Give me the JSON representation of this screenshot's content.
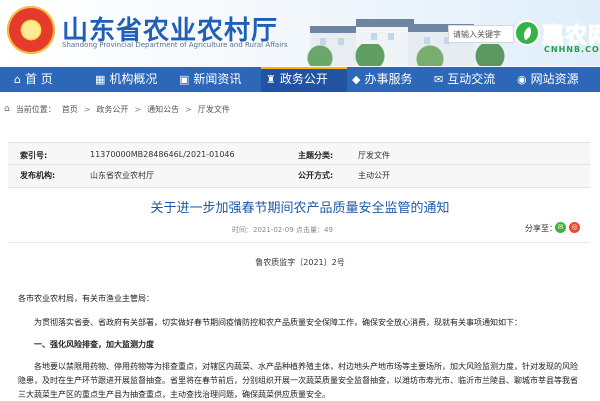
{
  "header": {
    "title": "山东省农业农村厅",
    "subtitle": "Shandong Provincial Department of Agriculture and Rural Affairs",
    "search_text": "请输入关键字",
    "logo_text": "惠农网",
    "logo_domain": "CNHNB.COM"
  },
  "nav": {
    "items": [
      {
        "label": "首 页",
        "icon": "home-icon"
      },
      {
        "label": "机构概况",
        "icon": "org-icon"
      },
      {
        "label": "新闻资讯",
        "icon": "news-icon"
      },
      {
        "label": "政务公开",
        "icon": "public-affairs-icon"
      },
      {
        "label": "办事服务",
        "icon": "service-icon"
      },
      {
        "label": "互动交流",
        "icon": "chat-icon"
      },
      {
        "label": "网站资源",
        "icon": "resource-icon"
      }
    ],
    "active": "政务公开"
  },
  "breadcrumb": {
    "prefix": "当前位置：",
    "items": [
      "首页",
      "政务公开",
      "通知公告",
      "厅发文件"
    ]
  },
  "meta": {
    "index_label": "索引号:",
    "index_value": "11370000MB2848646L/2021-01046",
    "category_label": "主题分类:",
    "category_value": "厅发文件",
    "publisher_label": "发布机构:",
    "publisher_value": "山东省农业农村厅",
    "type_label": "公开方式:",
    "type_value": "主动公开"
  },
  "article": {
    "title": "关于进一步加强春节期间农产品质量安全监管的通知",
    "date": "时间：2021-02-09",
    "views": "点击量：49",
    "share_label": "分享至：",
    "doc_number": "鲁农质监字〔2021〕2号",
    "body": {
      "greeting": "各市农业农村局，有关市渔业主管局：",
      "intro": "为贯彻落实省委、省政府有关部署，切实做好春节期间疫情防控和农产品质量安全保障工作，确保安全放心消费，现就有关事项通知如下：",
      "section1": "一、强化风险排查，加大监测力度",
      "para1_line1": "各地要以禁限用药物、停用药物等为排查重点，对辖区内蔬菜、水产品种植养殖主体，村边地头产地市场等主要场所，加大风险监测力度，针对发现的风险",
      "para1_line2": "隐患，及时在生产环节跟进开展监督抽查。省里将在春节前后，分别组织开展一次蔬菜质量安全监督抽查，以潍坊市寿光市、临沂市兰陵县、聊城市莘县等我省",
      "para1_line3": "三大蔬菜生产区的重点生产县为抽查重点，主动查找治理问题，确保蔬菜供应质量安全。"
    }
  },
  "colors": {
    "brand_blue": "#2d67b8",
    "title_blue": "#1f5fb7",
    "active_nav": "#2253a3",
    "logo_green": "#23a347"
  }
}
